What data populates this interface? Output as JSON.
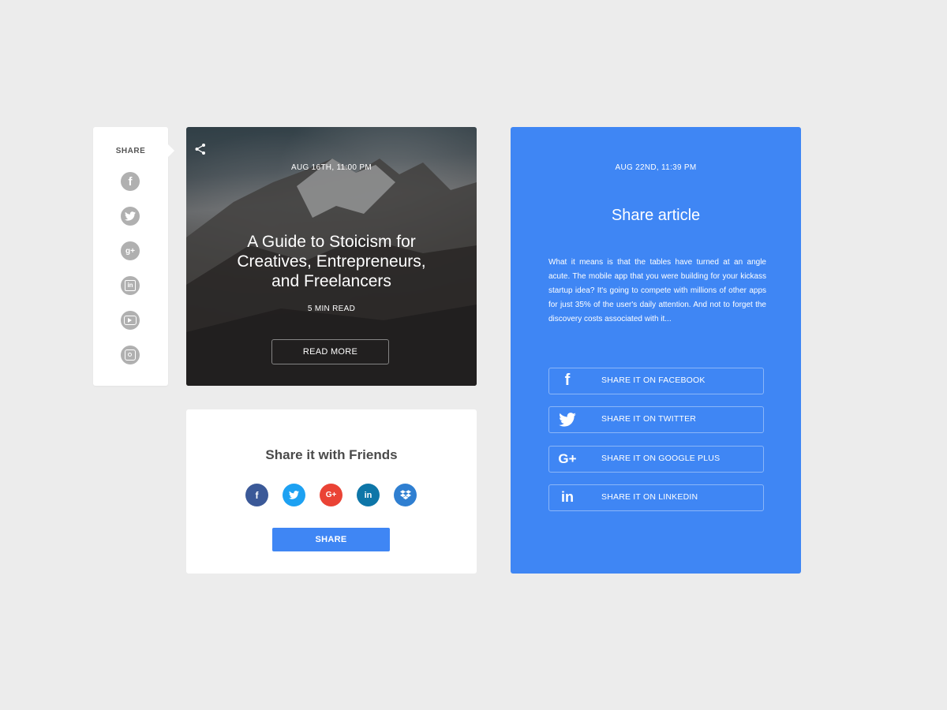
{
  "sidebar": {
    "title": "SHARE",
    "icons": [
      "facebook-icon",
      "twitter-icon",
      "google-plus-icon",
      "linkedin-icon",
      "youtube-icon",
      "instagram-icon"
    ],
    "icon_color": "#b0b0b0"
  },
  "hero": {
    "date": "AUG 16TH, 11:00 PM",
    "title": "A Guide to Stoicism for Creatives, Entrepreneurs, and Freelancers",
    "read_time": "5 MIN READ",
    "button_label": "READ MORE"
  },
  "friends": {
    "title": "Share it with Friends",
    "networks": [
      {
        "icon": "facebook-icon",
        "glyph": "f",
        "color": "#3b5998"
      },
      {
        "icon": "twitter-icon",
        "glyph": "",
        "color": "#1da1f2"
      },
      {
        "icon": "google-plus-icon",
        "glyph": "G+",
        "color": "#ea4335"
      },
      {
        "icon": "linkedin-icon",
        "glyph": "in",
        "color": "#0e76a8"
      },
      {
        "icon": "dropbox-icon",
        "glyph": "",
        "color": "#2f7fd1"
      }
    ],
    "button_label": "SHARE"
  },
  "panel": {
    "date": "AUG 22ND, 11:39 PM",
    "title": "Share article",
    "body": "What it means is that the tables have turned at an angle acute. The mobile app that you were building for your kickass startup idea? It's going to compete with millions of other apps for just 35% of the user's daily attention. And not to forget the discovery costs associated with it...",
    "buttons": [
      {
        "icon": "facebook-icon",
        "label": "SHARE IT ON FACEBOOK"
      },
      {
        "icon": "twitter-icon",
        "label": "SHARE IT ON TWITTER"
      },
      {
        "icon": "google-plus-icon",
        "label": "SHARE IT ON GOOGLE PLUS"
      },
      {
        "icon": "linkedin-icon",
        "label": "SHARE IT ON LINKEDIN"
      }
    ],
    "color": "#3f86f4"
  }
}
